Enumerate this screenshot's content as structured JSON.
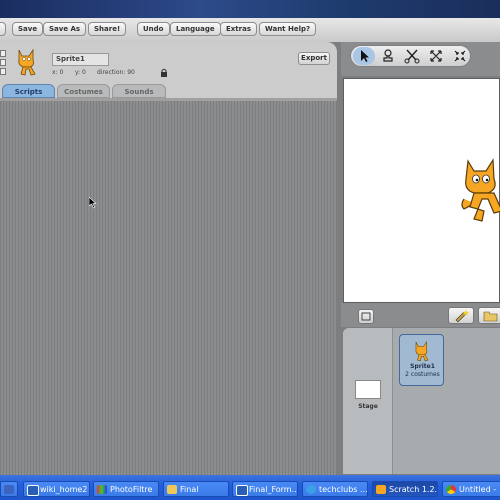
{
  "menu": {
    "save": "Save",
    "save_as": "Save As",
    "share": "Share!",
    "undo": "Undo",
    "language": "Language",
    "extras": "Extras",
    "want_help": "Want Help?"
  },
  "sprite": {
    "name": "Sprite1",
    "x_label": "x: 0",
    "y_label": "y: 0",
    "direction_label": "direction: 90",
    "export_label": "Export"
  },
  "tabs": [
    {
      "label": "Scripts",
      "active": true
    },
    {
      "label": "Costumes",
      "active": false
    },
    {
      "label": "Sounds",
      "active": false
    }
  ],
  "stage_tools": [
    "arrow-cursor-icon",
    "stamp-icon",
    "scissors-icon",
    "grow-icon",
    "shrink-icon"
  ],
  "sprite_list": {
    "stage_label": "Stage",
    "sprite_name": "Sprite1",
    "sprite_costumes": "2 costumes"
  },
  "taskbar": [
    {
      "label": "",
      "icon": "chevron-icon"
    },
    {
      "label": "wiki_home2",
      "icon": "document-icon"
    },
    {
      "label": "PhotoFiltre",
      "icon": "photofiltre-icon"
    },
    {
      "label": "Final",
      "icon": "folder-icon"
    },
    {
      "label": "Final_Form...",
      "icon": "document-icon"
    },
    {
      "label": "techclubs ...",
      "icon": "browser-icon"
    },
    {
      "label": "Scratch 1.2...",
      "icon": "scratch-icon"
    },
    {
      "label": "Untitled -",
      "icon": "chrome-icon"
    }
  ],
  "colors": {
    "script_area": "#8b8d8e",
    "active_tab": "#8ab6e0",
    "taskbar": "#245edb"
  }
}
